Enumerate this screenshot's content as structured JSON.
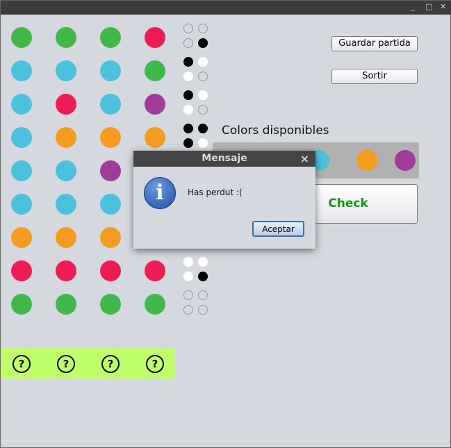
{
  "window": {
    "minimize": "_",
    "maximize": "□",
    "close": "✕"
  },
  "colors": {
    "green": "#43b84a",
    "red": "#ee1c55",
    "cyan": "#4cc1dc",
    "purple": "#a03b98",
    "orange": "#f49c22"
  },
  "board": [
    {
      "guess": [
        "green",
        "green",
        "green",
        "red"
      ],
      "pegs": [
        "empty",
        "empty",
        "empty",
        "black"
      ]
    },
    {
      "guess": [
        "cyan",
        "cyan",
        "cyan",
        "green"
      ],
      "pegs": [
        "black",
        "white",
        "white",
        "empty"
      ]
    },
    {
      "guess": [
        "cyan",
        "red",
        "cyan",
        "purple"
      ],
      "pegs": [
        "black",
        "white",
        "white",
        "empty"
      ]
    },
    {
      "guess": [
        "cyan",
        "orange",
        "orange",
        "orange"
      ],
      "pegs": [
        "black",
        "black",
        "black",
        "white"
      ]
    },
    {
      "guess": [
        "cyan",
        "cyan",
        "purple",
        null
      ],
      "pegs": []
    },
    {
      "guess": [
        "cyan",
        "cyan",
        "cyan",
        null
      ],
      "pegs": []
    },
    {
      "guess": [
        "orange",
        "orange",
        "orange",
        null
      ],
      "pegs": []
    },
    {
      "guess": [
        "red",
        "red",
        "red",
        "red"
      ],
      "pegs": [
        "white",
        "white",
        "white",
        "black"
      ]
    },
    {
      "guess": [
        "green",
        "green",
        "green",
        "green"
      ],
      "pegs": [
        "empty",
        "empty",
        "empty",
        "empty"
      ]
    }
  ],
  "answer": [
    "?",
    "?",
    "?",
    "?"
  ],
  "buttons": {
    "save": "Guardar partida",
    "sort": "Sortir",
    "check": "Check"
  },
  "available_title": "Colors disponibles",
  "available": [
    "cyan",
    "orange",
    "purple"
  ],
  "dialog": {
    "title": "Mensaje",
    "close": "×",
    "message": "Has perdut :(",
    "ok": "Aceptar",
    "icon": "i"
  }
}
